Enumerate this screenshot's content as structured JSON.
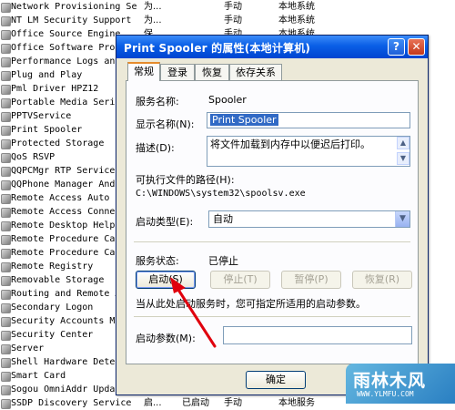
{
  "services": [
    {
      "name": "Network Provisioning Se...",
      "desc": "为...",
      "status": "",
      "startup": "手动",
      "logon": "本地系统"
    },
    {
      "name": "NT LM Security Support ...",
      "desc": "为...",
      "status": "",
      "startup": "手动",
      "logon": "本地系统"
    },
    {
      "name": "Office  Source Engine",
      "desc": "保...",
      "status": "",
      "startup": "手动",
      "logon": "本地系统"
    },
    {
      "name": "Office Software Protec",
      "desc": "",
      "status": "",
      "startup": "",
      "logon": ""
    },
    {
      "name": "Performance Logs and A",
      "desc": "",
      "status": "",
      "startup": "",
      "logon": ""
    },
    {
      "name": "Plug and Play",
      "desc": "",
      "status": "",
      "startup": "",
      "logon": ""
    },
    {
      "name": "Pml Driver HPZ12",
      "desc": "",
      "status": "",
      "startup": "",
      "logon": ""
    },
    {
      "name": "Portable Media Serial N",
      "desc": "",
      "status": "",
      "startup": "",
      "logon": ""
    },
    {
      "name": "PPTVService",
      "desc": "",
      "status": "",
      "startup": "",
      "logon": ""
    },
    {
      "name": "Print Spooler",
      "desc": "",
      "status": "",
      "startup": "",
      "logon": ""
    },
    {
      "name": "Protected Storage",
      "desc": "",
      "status": "",
      "startup": "",
      "logon": ""
    },
    {
      "name": "QoS RSVP",
      "desc": "",
      "status": "",
      "startup": "",
      "logon": ""
    },
    {
      "name": "QQPCMgr RTP Service",
      "desc": "",
      "status": "",
      "startup": "",
      "logon": ""
    },
    {
      "name": "QQPhone Manager Androi",
      "desc": "",
      "status": "",
      "startup": "",
      "logon": ""
    },
    {
      "name": "Remote Access Auto Conn",
      "desc": "",
      "status": "",
      "startup": "",
      "logon": ""
    },
    {
      "name": "Remote Access Connectio",
      "desc": "",
      "status": "",
      "startup": "",
      "logon": ""
    },
    {
      "name": "Remote Desktop Help Se",
      "desc": "",
      "status": "",
      "startup": "",
      "logon": ""
    },
    {
      "name": "Remote Procedure Call",
      "desc": "",
      "status": "",
      "startup": "",
      "logon": ""
    },
    {
      "name": "Remote Procedure Call",
      "desc": "",
      "status": "",
      "startup": "",
      "logon": ""
    },
    {
      "name": "Remote Registry",
      "desc": "",
      "status": "",
      "startup": "",
      "logon": ""
    },
    {
      "name": "Removable Storage",
      "desc": "",
      "status": "",
      "startup": "",
      "logon": ""
    },
    {
      "name": "Routing and Remote Acc",
      "desc": "",
      "status": "",
      "startup": "",
      "logon": ""
    },
    {
      "name": "Secondary Logon",
      "desc": "",
      "status": "",
      "startup": "",
      "logon": ""
    },
    {
      "name": "Security Accounts Mana",
      "desc": "",
      "status": "",
      "startup": "",
      "logon": ""
    },
    {
      "name": "Security Center",
      "desc": "",
      "status": "",
      "startup": "",
      "logon": ""
    },
    {
      "name": "Server",
      "desc": "",
      "status": "",
      "startup": "",
      "logon": ""
    },
    {
      "name": "Shell Hardware Detecti",
      "desc": "",
      "status": "",
      "startup": "",
      "logon": ""
    },
    {
      "name": "Smart Card",
      "desc": "",
      "status": "",
      "startup": "",
      "logon": ""
    },
    {
      "name": "Sogou OmniAddr Update S",
      "desc": "",
      "status": "",
      "startup": "",
      "logon": ""
    },
    {
      "name": "SSDP Discovery Service",
      "desc": "启...",
      "status": "已启动",
      "startup": "手动",
      "logon": "本地服务"
    }
  ],
  "dialog": {
    "title": "Print Spooler 的属性(本地计算机)",
    "help": "?",
    "close": "✕",
    "tabs": [
      "常规",
      "登录",
      "恢复",
      "依存关系"
    ],
    "service_name_label": "服务名称:",
    "service_name": "Spooler",
    "display_name_label": "显示名称(N):",
    "display_name": "Print Spooler",
    "description_label": "描述(D):",
    "description": "将文件加载到内存中以便迟后打印。",
    "exec_path_label": "可执行文件的路径(H):",
    "exec_path": "C:\\WINDOWS\\system32\\spoolsv.exe",
    "startup_type_label": "启动类型(E):",
    "startup_type": "自动",
    "status_label": "服务状态:",
    "status": "已停止",
    "buttons": {
      "start": "启动(S)",
      "stop": "停止(T)",
      "pause": "暂停(P)",
      "resume": "恢复(R)"
    },
    "hint": "当从此处启动服务时，您可指定所适用的启动参数。",
    "start_params_label": "启动参数(M):",
    "start_params_value": "",
    "ok": "确定"
  },
  "watermark": {
    "big": "雨林木风",
    "small": "WWW.YLMFU.COM"
  }
}
